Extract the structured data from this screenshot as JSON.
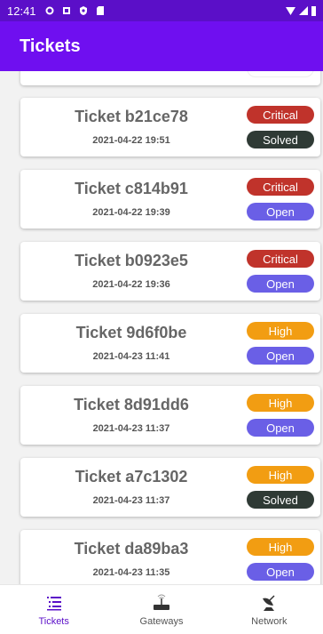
{
  "status_bar": {
    "time": "12:41"
  },
  "app_bar": {
    "title": "Tickets"
  },
  "colors": {
    "primary": "#6f0ff0",
    "status_bar": "#5b0fc8",
    "critical": "#c0332b",
    "high": "#f29d12",
    "open": "#6a5fe6",
    "solved": "#2f3a35"
  },
  "tickets": [
    {
      "title": "Ticket b21ce78",
      "date": "2021-04-22 19:51",
      "priority": "Critical",
      "status": "Solved"
    },
    {
      "title": "Ticket c814b91",
      "date": "2021-04-22 19:39",
      "priority": "Critical",
      "status": "Open"
    },
    {
      "title": "Ticket b0923e5",
      "date": "2021-04-22 19:36",
      "priority": "Critical",
      "status": "Open"
    },
    {
      "title": "Ticket 9d6f0be",
      "date": "2021-04-23 11:41",
      "priority": "High",
      "status": "Open"
    },
    {
      "title": "Ticket 8d91dd6",
      "date": "2021-04-23 11:37",
      "priority": "High",
      "status": "Open"
    },
    {
      "title": "Ticket a7c1302",
      "date": "2021-04-23 11:37",
      "priority": "High",
      "status": "Solved"
    },
    {
      "title": "Ticket da89ba3",
      "date": "2021-04-23 11:35",
      "priority": "High",
      "status": "Open"
    }
  ],
  "bottom_nav": {
    "items": [
      {
        "label": "Tickets",
        "icon": "list-icon",
        "active": true
      },
      {
        "label": "Gateways",
        "icon": "router-icon",
        "active": false
      },
      {
        "label": "Network",
        "icon": "satellite-dish-icon",
        "active": false
      }
    ]
  }
}
